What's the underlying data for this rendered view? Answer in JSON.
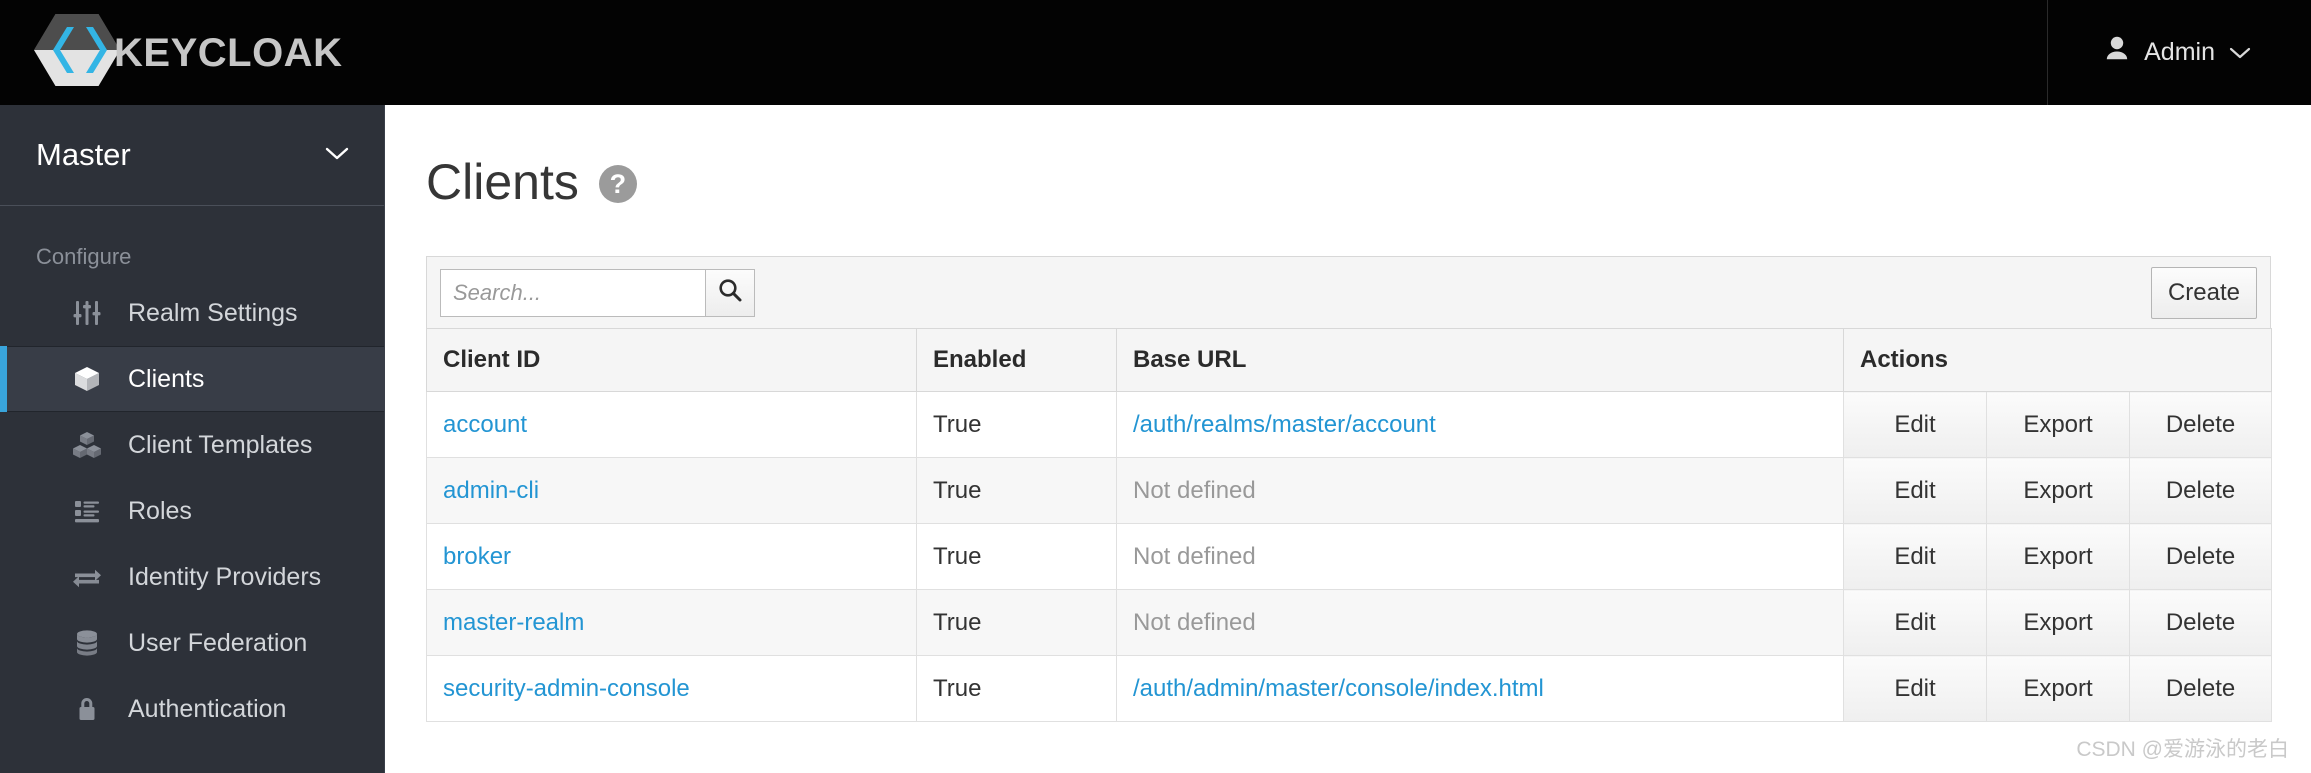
{
  "header": {
    "brand_text": "KEYCLOAK",
    "brand_logo_name": "keycloak-hexagon-logo",
    "user_label": "Admin"
  },
  "sidebar": {
    "realm": {
      "name": "Master"
    },
    "section_label": "Configure",
    "items": [
      {
        "label": "Realm Settings",
        "icon": "sliders-icon",
        "active": false
      },
      {
        "label": "Clients",
        "icon": "cube-icon",
        "active": true
      },
      {
        "label": "Client Templates",
        "icon": "cubes-icon",
        "active": false
      },
      {
        "label": "Roles",
        "icon": "list-icon",
        "active": false
      },
      {
        "label": "Identity Providers",
        "icon": "exchange-arrows-icon",
        "active": false
      },
      {
        "label": "User Federation",
        "icon": "database-icon",
        "active": false
      },
      {
        "label": "Authentication",
        "icon": "lock-icon",
        "active": false
      }
    ]
  },
  "main": {
    "title": "Clients",
    "help_icon_label": "?",
    "toolbar": {
      "search_placeholder": "Search...",
      "search_value": "",
      "create_label": "Create"
    },
    "table": {
      "columns": [
        "Client ID",
        "Enabled",
        "Base URL",
        "Actions"
      ],
      "action_labels": [
        "Edit",
        "Export",
        "Delete"
      ],
      "not_defined_text": "Not defined",
      "rows": [
        {
          "client_id": "account",
          "enabled": "True",
          "base_url": "/auth/realms/master/account",
          "base_url_defined": true
        },
        {
          "client_id": "admin-cli",
          "enabled": "True",
          "base_url": "Not defined",
          "base_url_defined": false
        },
        {
          "client_id": "broker",
          "enabled": "True",
          "base_url": "Not defined",
          "base_url_defined": false
        },
        {
          "client_id": "master-realm",
          "enabled": "True",
          "base_url": "Not defined",
          "base_url_defined": false
        },
        {
          "client_id": "security-admin-console",
          "enabled": "True",
          "base_url": "/auth/admin/master/console/index.html",
          "base_url_defined": true
        }
      ]
    }
  },
  "watermark": "CSDN @爱游泳的老白",
  "colors": {
    "topbar_bg": "#030303",
    "sidebar_bg": "#2d3139",
    "sidebar_active_bg": "#383d47",
    "accent_blue": "#39a5dc",
    "link_blue": "#2395d3",
    "logo_cyan": "#33b5e5",
    "panel_bg": "#f5f5f5"
  }
}
